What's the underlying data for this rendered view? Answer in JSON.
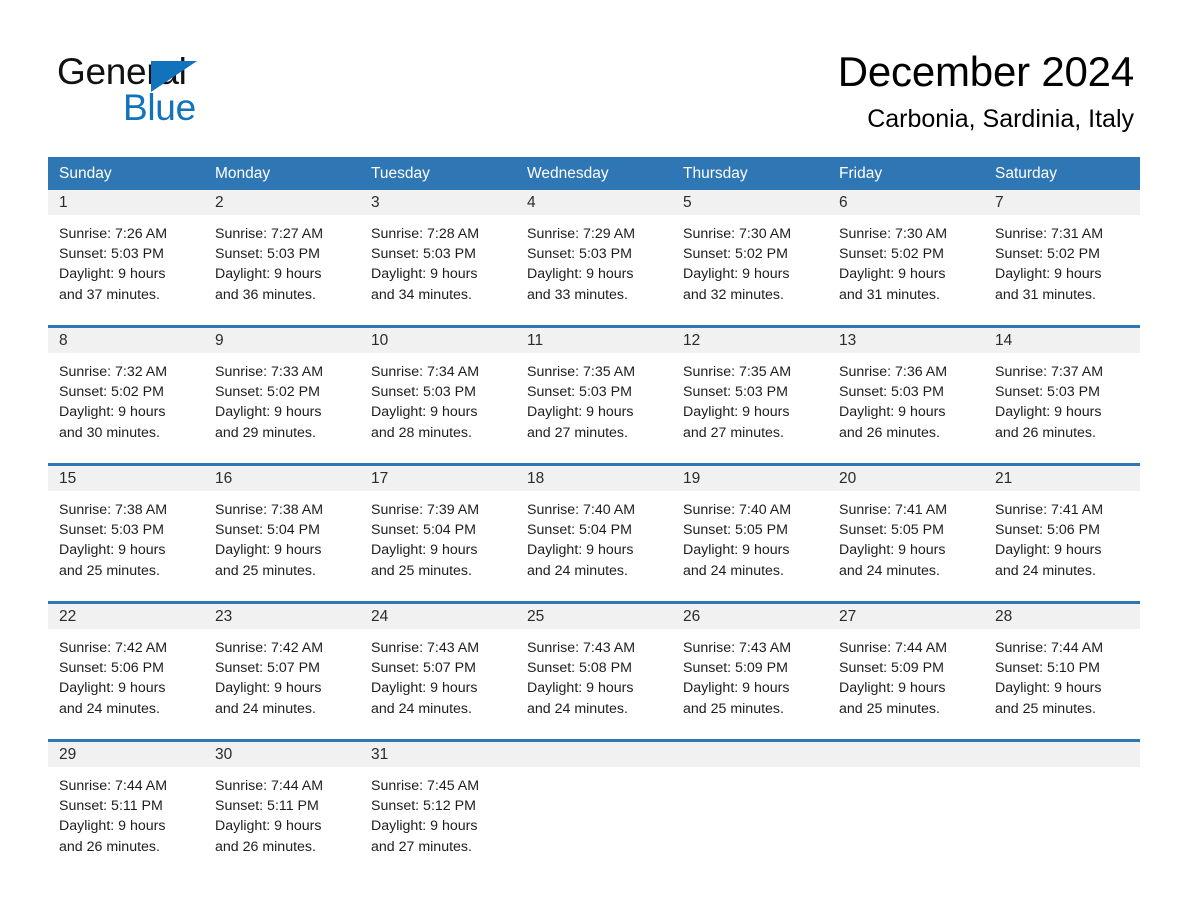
{
  "brand": {
    "logo_text_top": "General",
    "logo_text_bottom": "Blue",
    "accent_color": "#1073bb",
    "triangle_icon": "brand-triangle-icon"
  },
  "header": {
    "title": "December 2024",
    "location": "Carbonia, Sardinia, Italy"
  },
  "calendar": {
    "header_bg": "#2f76b5",
    "date_band_bg": "#f1f1f1",
    "weekdays": [
      "Sunday",
      "Monday",
      "Tuesday",
      "Wednesday",
      "Thursday",
      "Friday",
      "Saturday"
    ],
    "weeks": [
      [
        {
          "date": "1",
          "sunrise": "Sunrise: 7:26 AM",
          "sunset": "Sunset: 5:03 PM",
          "daylight_line1": "Daylight: 9 hours",
          "daylight_line2": "and 37 minutes."
        },
        {
          "date": "2",
          "sunrise": "Sunrise: 7:27 AM",
          "sunset": "Sunset: 5:03 PM",
          "daylight_line1": "Daylight: 9 hours",
          "daylight_line2": "and 36 minutes."
        },
        {
          "date": "3",
          "sunrise": "Sunrise: 7:28 AM",
          "sunset": "Sunset: 5:03 PM",
          "daylight_line1": "Daylight: 9 hours",
          "daylight_line2": "and 34 minutes."
        },
        {
          "date": "4",
          "sunrise": "Sunrise: 7:29 AM",
          "sunset": "Sunset: 5:03 PM",
          "daylight_line1": "Daylight: 9 hours",
          "daylight_line2": "and 33 minutes."
        },
        {
          "date": "5",
          "sunrise": "Sunrise: 7:30 AM",
          "sunset": "Sunset: 5:02 PM",
          "daylight_line1": "Daylight: 9 hours",
          "daylight_line2": "and 32 minutes."
        },
        {
          "date": "6",
          "sunrise": "Sunrise: 7:30 AM",
          "sunset": "Sunset: 5:02 PM",
          "daylight_line1": "Daylight: 9 hours",
          "daylight_line2": "and 31 minutes."
        },
        {
          "date": "7",
          "sunrise": "Sunrise: 7:31 AM",
          "sunset": "Sunset: 5:02 PM",
          "daylight_line1": "Daylight: 9 hours",
          "daylight_line2": "and 31 minutes."
        }
      ],
      [
        {
          "date": "8",
          "sunrise": "Sunrise: 7:32 AM",
          "sunset": "Sunset: 5:02 PM",
          "daylight_line1": "Daylight: 9 hours",
          "daylight_line2": "and 30 minutes."
        },
        {
          "date": "9",
          "sunrise": "Sunrise: 7:33 AM",
          "sunset": "Sunset: 5:02 PM",
          "daylight_line1": "Daylight: 9 hours",
          "daylight_line2": "and 29 minutes."
        },
        {
          "date": "10",
          "sunrise": "Sunrise: 7:34 AM",
          "sunset": "Sunset: 5:03 PM",
          "daylight_line1": "Daylight: 9 hours",
          "daylight_line2": "and 28 minutes."
        },
        {
          "date": "11",
          "sunrise": "Sunrise: 7:35 AM",
          "sunset": "Sunset: 5:03 PM",
          "daylight_line1": "Daylight: 9 hours",
          "daylight_line2": "and 27 minutes."
        },
        {
          "date": "12",
          "sunrise": "Sunrise: 7:35 AM",
          "sunset": "Sunset: 5:03 PM",
          "daylight_line1": "Daylight: 9 hours",
          "daylight_line2": "and 27 minutes."
        },
        {
          "date": "13",
          "sunrise": "Sunrise: 7:36 AM",
          "sunset": "Sunset: 5:03 PM",
          "daylight_line1": "Daylight: 9 hours",
          "daylight_line2": "and 26 minutes."
        },
        {
          "date": "14",
          "sunrise": "Sunrise: 7:37 AM",
          "sunset": "Sunset: 5:03 PM",
          "daylight_line1": "Daylight: 9 hours",
          "daylight_line2": "and 26 minutes."
        }
      ],
      [
        {
          "date": "15",
          "sunrise": "Sunrise: 7:38 AM",
          "sunset": "Sunset: 5:03 PM",
          "daylight_line1": "Daylight: 9 hours",
          "daylight_line2": "and 25 minutes."
        },
        {
          "date": "16",
          "sunrise": "Sunrise: 7:38 AM",
          "sunset": "Sunset: 5:04 PM",
          "daylight_line1": "Daylight: 9 hours",
          "daylight_line2": "and 25 minutes."
        },
        {
          "date": "17",
          "sunrise": "Sunrise: 7:39 AM",
          "sunset": "Sunset: 5:04 PM",
          "daylight_line1": "Daylight: 9 hours",
          "daylight_line2": "and 25 minutes."
        },
        {
          "date": "18",
          "sunrise": "Sunrise: 7:40 AM",
          "sunset": "Sunset: 5:04 PM",
          "daylight_line1": "Daylight: 9 hours",
          "daylight_line2": "and 24 minutes."
        },
        {
          "date": "19",
          "sunrise": "Sunrise: 7:40 AM",
          "sunset": "Sunset: 5:05 PM",
          "daylight_line1": "Daylight: 9 hours",
          "daylight_line2": "and 24 minutes."
        },
        {
          "date": "20",
          "sunrise": "Sunrise: 7:41 AM",
          "sunset": "Sunset: 5:05 PM",
          "daylight_line1": "Daylight: 9 hours",
          "daylight_line2": "and 24 minutes."
        },
        {
          "date": "21",
          "sunrise": "Sunrise: 7:41 AM",
          "sunset": "Sunset: 5:06 PM",
          "daylight_line1": "Daylight: 9 hours",
          "daylight_line2": "and 24 minutes."
        }
      ],
      [
        {
          "date": "22",
          "sunrise": "Sunrise: 7:42 AM",
          "sunset": "Sunset: 5:06 PM",
          "daylight_line1": "Daylight: 9 hours",
          "daylight_line2": "and 24 minutes."
        },
        {
          "date": "23",
          "sunrise": "Sunrise: 7:42 AM",
          "sunset": "Sunset: 5:07 PM",
          "daylight_line1": "Daylight: 9 hours",
          "daylight_line2": "and 24 minutes."
        },
        {
          "date": "24",
          "sunrise": "Sunrise: 7:43 AM",
          "sunset": "Sunset: 5:07 PM",
          "daylight_line1": "Daylight: 9 hours",
          "daylight_line2": "and 24 minutes."
        },
        {
          "date": "25",
          "sunrise": "Sunrise: 7:43 AM",
          "sunset": "Sunset: 5:08 PM",
          "daylight_line1": "Daylight: 9 hours",
          "daylight_line2": "and 24 minutes."
        },
        {
          "date": "26",
          "sunrise": "Sunrise: 7:43 AM",
          "sunset": "Sunset: 5:09 PM",
          "daylight_line1": "Daylight: 9 hours",
          "daylight_line2": "and 25 minutes."
        },
        {
          "date": "27",
          "sunrise": "Sunrise: 7:44 AM",
          "sunset": "Sunset: 5:09 PM",
          "daylight_line1": "Daylight: 9 hours",
          "daylight_line2": "and 25 minutes."
        },
        {
          "date": "28",
          "sunrise": "Sunrise: 7:44 AM",
          "sunset": "Sunset: 5:10 PM",
          "daylight_line1": "Daylight: 9 hours",
          "daylight_line2": "and 25 minutes."
        }
      ],
      [
        {
          "date": "29",
          "sunrise": "Sunrise: 7:44 AM",
          "sunset": "Sunset: 5:11 PM",
          "daylight_line1": "Daylight: 9 hours",
          "daylight_line2": "and 26 minutes."
        },
        {
          "date": "30",
          "sunrise": "Sunrise: 7:44 AM",
          "sunset": "Sunset: 5:11 PM",
          "daylight_line1": "Daylight: 9 hours",
          "daylight_line2": "and 26 minutes."
        },
        {
          "date": "31",
          "sunrise": "Sunrise: 7:45 AM",
          "sunset": "Sunset: 5:12 PM",
          "daylight_line1": "Daylight: 9 hours",
          "daylight_line2": "and 27 minutes."
        },
        {
          "date": "",
          "sunrise": "",
          "sunset": "",
          "daylight_line1": "",
          "daylight_line2": ""
        },
        {
          "date": "",
          "sunrise": "",
          "sunset": "",
          "daylight_line1": "",
          "daylight_line2": ""
        },
        {
          "date": "",
          "sunrise": "",
          "sunset": "",
          "daylight_line1": "",
          "daylight_line2": ""
        },
        {
          "date": "",
          "sunrise": "",
          "sunset": "",
          "daylight_line1": "",
          "daylight_line2": ""
        }
      ]
    ]
  }
}
